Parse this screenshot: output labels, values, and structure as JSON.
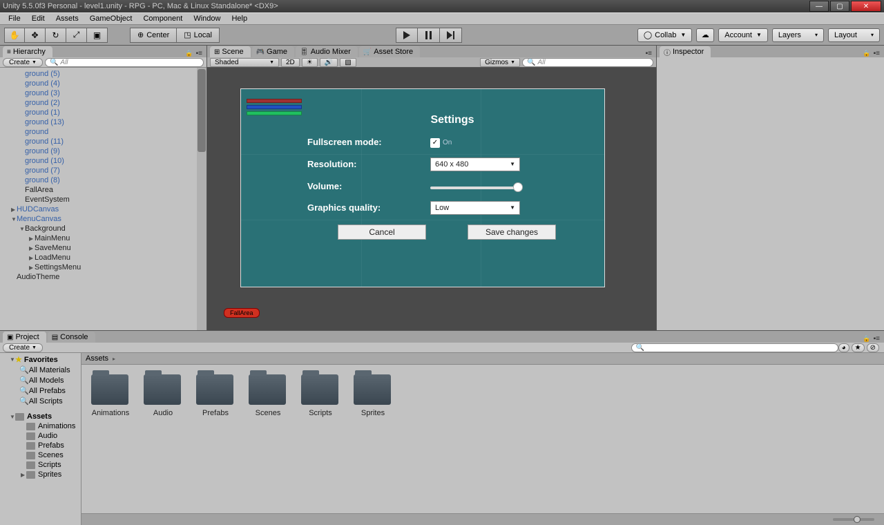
{
  "window": {
    "title": "Unity 5.5.0f3 Personal - level1.unity - RPG - PC, Mac & Linux Standalone* <DX9>"
  },
  "menu": [
    "File",
    "Edit",
    "Assets",
    "GameObject",
    "Component",
    "Window",
    "Help"
  ],
  "toolbar": {
    "center_label": "Center",
    "local_label": "Local",
    "collab": "Collab",
    "account": "Account",
    "layers": "Layers",
    "layout": "Layout"
  },
  "panels": {
    "hierarchy": "Hierarchy",
    "inspector": "Inspector",
    "scene": "Scene",
    "game": "Game",
    "audio": "Audio Mixer",
    "store": "Asset Store",
    "project": "Project",
    "console": "Console"
  },
  "hierarchy": {
    "create": "Create",
    "search_ph": "All",
    "items": [
      {
        "label": "ground (5)",
        "cls": "blue",
        "indent": 1
      },
      {
        "label": "ground (4)",
        "cls": "blue",
        "indent": 1
      },
      {
        "label": "ground (3)",
        "cls": "blue",
        "indent": 1
      },
      {
        "label": "ground (2)",
        "cls": "blue",
        "indent": 1
      },
      {
        "label": "ground (1)",
        "cls": "blue",
        "indent": 1
      },
      {
        "label": "ground (13)",
        "cls": "blue",
        "indent": 1
      },
      {
        "label": "ground",
        "cls": "blue",
        "indent": 1
      },
      {
        "label": "ground (11)",
        "cls": "blue",
        "indent": 1
      },
      {
        "label": "ground (9)",
        "cls": "blue",
        "indent": 1
      },
      {
        "label": "ground (10)",
        "cls": "blue",
        "indent": 1
      },
      {
        "label": "ground (7)",
        "cls": "blue",
        "indent": 1
      },
      {
        "label": "ground (8)",
        "cls": "blue",
        "indent": 1
      },
      {
        "label": "FallArea",
        "cls": "plain",
        "indent": 1
      },
      {
        "label": "EventSystem",
        "cls": "plain",
        "indent": 1
      },
      {
        "label": "HUDCanvas",
        "cls": "blue",
        "indent": 0,
        "tri": "▶"
      },
      {
        "label": "MenuCanvas",
        "cls": "blue",
        "indent": 0,
        "tri": "▼"
      },
      {
        "label": "Background",
        "cls": "plain",
        "indent": 1,
        "tri": "▼"
      },
      {
        "label": "MainMenu",
        "cls": "plain",
        "indent": 2,
        "tri": "▶"
      },
      {
        "label": "SaveMenu",
        "cls": "plain",
        "indent": 2,
        "tri": "▶"
      },
      {
        "label": "LoadMenu",
        "cls": "plain",
        "indent": 2,
        "tri": "▶"
      },
      {
        "label": "SettingsMenu",
        "cls": "plain",
        "indent": 2,
        "tri": "▶"
      },
      {
        "label": "AudioTheme",
        "cls": "plain",
        "indent": 0
      }
    ]
  },
  "scene_toolbar": {
    "shaded": "Shaded",
    "mode2d": "2D",
    "gizmos": "Gizmos",
    "search_ph": "All"
  },
  "settings_ui": {
    "title": "Settings",
    "fullscreen": "Fullscreen mode:",
    "fullscreen_on": "On",
    "resolution": "Resolution:",
    "resolution_val": "640 x 480",
    "volume": "Volume:",
    "graphics": "Graphics quality:",
    "graphics_val": "Low",
    "cancel": "Cancel",
    "save": "Save changes"
  },
  "fallarea_label": "FallArea",
  "project": {
    "create": "Create",
    "favorites": "Favorites",
    "fav_items": [
      "All Materials",
      "All Models",
      "All Prefabs",
      "All Scripts"
    ],
    "assets": "Assets",
    "folders": [
      "Animations",
      "Audio",
      "Prefabs",
      "Scenes",
      "Scripts",
      "Sprites"
    ],
    "breadcrumb": "Assets",
    "grid": [
      "Animations",
      "Audio",
      "Prefabs",
      "Scenes",
      "Scripts",
      "Sprites"
    ]
  }
}
